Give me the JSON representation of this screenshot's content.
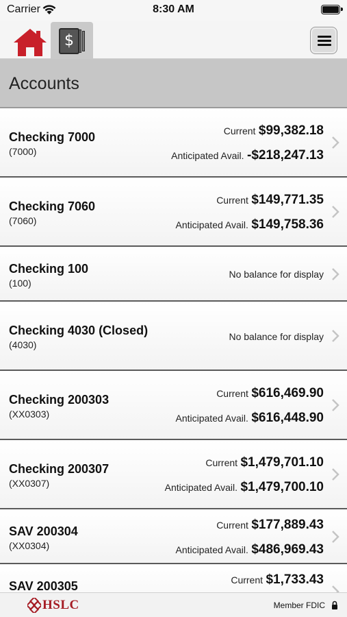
{
  "status_bar": {
    "carrier": "Carrier",
    "time": "8:30 AM"
  },
  "nav": {
    "home_icon": "home-icon",
    "accounts_icon": "statement-dollar-icon",
    "accounts_icon_glyph": "$",
    "menu_icon": "hamburger-menu-icon",
    "home_color": "#c8202a"
  },
  "section": {
    "title": "Accounts"
  },
  "accounts": [
    {
      "name": "Checking 7000",
      "number": "(7000)",
      "current_label": "Current",
      "current": "$99,382.18",
      "anticipated_label": "Anticipated Avail.",
      "anticipated": "-$218,247.13"
    },
    {
      "name": "Checking 7060",
      "number": "(7060)",
      "current_label": "Current",
      "current": "$149,771.35",
      "anticipated_label": "Anticipated Avail.",
      "anticipated": "$149,758.36"
    },
    {
      "name": "Checking 100",
      "number": "(100)",
      "no_balance": "No balance for display"
    },
    {
      "name": "Checking 4030 (Closed)",
      "number": "(4030)",
      "no_balance": "No balance for display"
    },
    {
      "name": "Checking 200303",
      "number": "(XX0303)",
      "current_label": "Current",
      "current": "$616,469.90",
      "anticipated_label": "Anticipated Avail.",
      "anticipated": "$616,448.90"
    },
    {
      "name": "Checking 200307",
      "number": "(XX0307)",
      "current_label": "Current",
      "current": "$1,479,701.10",
      "anticipated_label": "Anticipated Avail.",
      "anticipated": "$1,479,700.10"
    },
    {
      "name": "SAV 200304",
      "number": "(XX0304)",
      "current_label": "Current",
      "current": "$177,889.43",
      "anticipated_label": "Anticipated Avail.",
      "anticipated": "$486,969.43"
    },
    {
      "name": "SAV 200305",
      "number": "",
      "current_label": "Current",
      "current": "$1,733.43"
    }
  ],
  "footer": {
    "logo_text": "HSLC",
    "logo_color": "#a51c24",
    "member_fdic": "Member FDIC",
    "lock_icon": "lock-icon"
  }
}
